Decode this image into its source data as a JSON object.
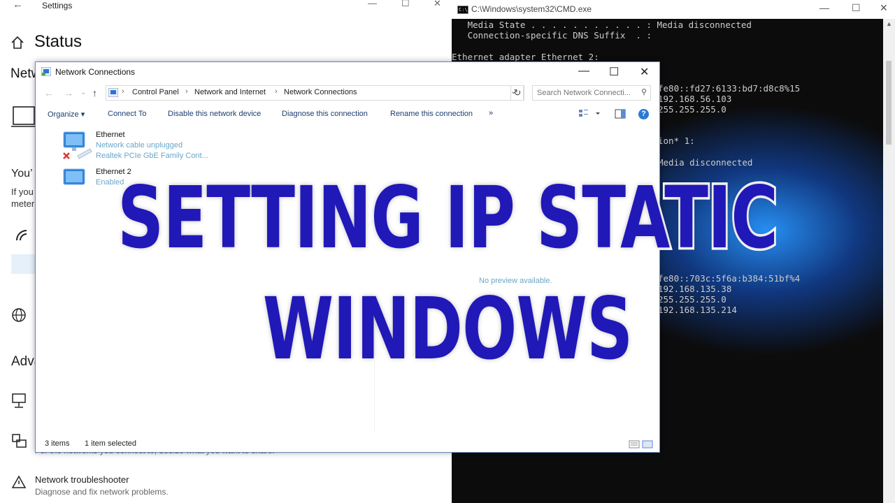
{
  "settings": {
    "back_glyph": "←",
    "title": "Settings",
    "min_glyph": "—",
    "max_glyph": "☐",
    "close_glyph": "✕",
    "heading": "Status",
    "network_partial": "Netw",
    "youre_partial": "You’",
    "ifyou_partial": "If you",
    "meter_partial": "meter",
    "advanced_partial": "Adva",
    "partial_text": "For the networks you connect to, decide what you want to share.",
    "troubleshooter": "Network troubleshooter",
    "troubleshooter_sub": "Diagnose and fix network problems."
  },
  "cmd": {
    "title": "C:\\Windows\\system32\\CMD.exe",
    "icon_text": "C:\\",
    "min_glyph": "—",
    "max_glyph": "☐",
    "close_glyph": "✕",
    "lines_top": "   Media State . . . . . . . . . . . : Media disconnected\n   Connection-specific DNS Suffix  . :\n\nEthernet adapter Ethernet 2:",
    "line_fe80_1": "fe80::fd27:6133:bd7:d8c8%15",
    "line_ip_1": "192.168.56.103",
    "line_mask_1": "255.255.255.0",
    "line_adapter_partial": "ion* 1:",
    "line_media": "Media disconnected",
    "line_fe80_2": "fe80::703c:5f6a:b384:51bf%4",
    "line_ip_2": "192.168.135.38",
    "line_mask_2": "255.255.255.0",
    "line_gw_2": "192.168.135.214"
  },
  "netconn": {
    "title": "Network Connections",
    "min_glyph": "—",
    "max_glyph": "☐",
    "close_glyph": "✕",
    "breadcrumb": [
      "Control Panel",
      "Network and Internet",
      "Network Connections"
    ],
    "search_placeholder": "Search Network Connecti...",
    "toolbar": {
      "organize": "Organize",
      "connect_to": "Connect To",
      "disable": "Disable this network device",
      "diagnose": "Diagnose this connection",
      "rename": "Rename this connection",
      "more": "»"
    },
    "connections": [
      {
        "name": "Ethernet",
        "status": "Network cable unplugged",
        "device": "Realtek PCIe GbE Family Cont..."
      },
      {
        "name": "Ethernet 2",
        "status": "Enabled",
        "device": ""
      }
    ],
    "preview": "No preview available.",
    "status_items": "3 items",
    "status_selected": "1 item selected"
  },
  "banner": {
    "text": "SETTING IP STATIC WINDOWS"
  },
  "colors": {
    "banner_fill": "#2118b8",
    "banner_stroke": "#ffffff",
    "cmd_background": "#0c0c0c",
    "cmd_glow": "#2896ff",
    "link_blue": "#6aa6c9"
  }
}
